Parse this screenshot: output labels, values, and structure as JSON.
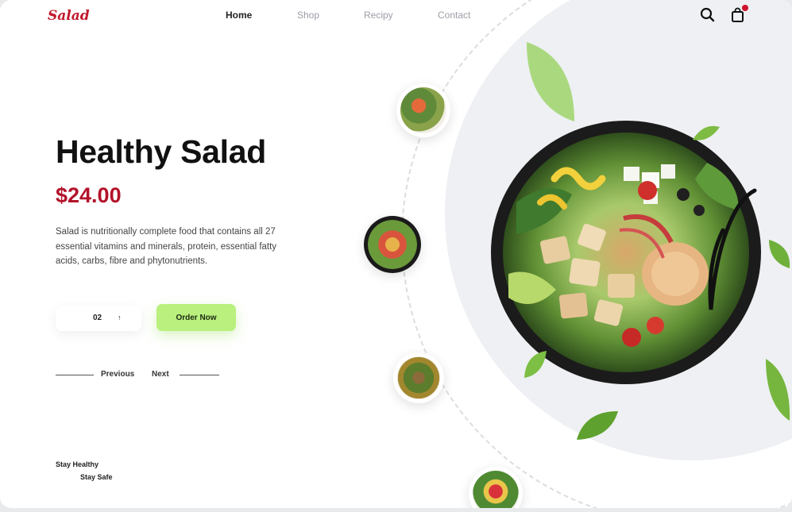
{
  "brand": {
    "logo": "Salad"
  },
  "nav": {
    "items": [
      "Home",
      "Shop",
      "Recipy",
      "Contact"
    ],
    "active": "Home"
  },
  "header_icons": {
    "search": "search-icon",
    "cart": "shopping-bag-icon",
    "cart_badge_color": "#d0142c"
  },
  "hero": {
    "title": "Healthy Salad",
    "price": "$24.00",
    "description": "Salad is nutritionally complete food that contains all 27 essential vitamins and minerals, protein, essential fatty acids, carbs, fibre and phytonutrients."
  },
  "quantity": {
    "value": "02",
    "stepper": "↑"
  },
  "order_button": "Order Now",
  "pager": {
    "previous": "Previous",
    "next": "Next"
  },
  "motto": {
    "line1": "Stay Healthy",
    "line2": "Stay Safe"
  },
  "colors": {
    "accent": "#b3122a",
    "button": "#b9f07e",
    "bg_circle": "#eef0f3"
  }
}
